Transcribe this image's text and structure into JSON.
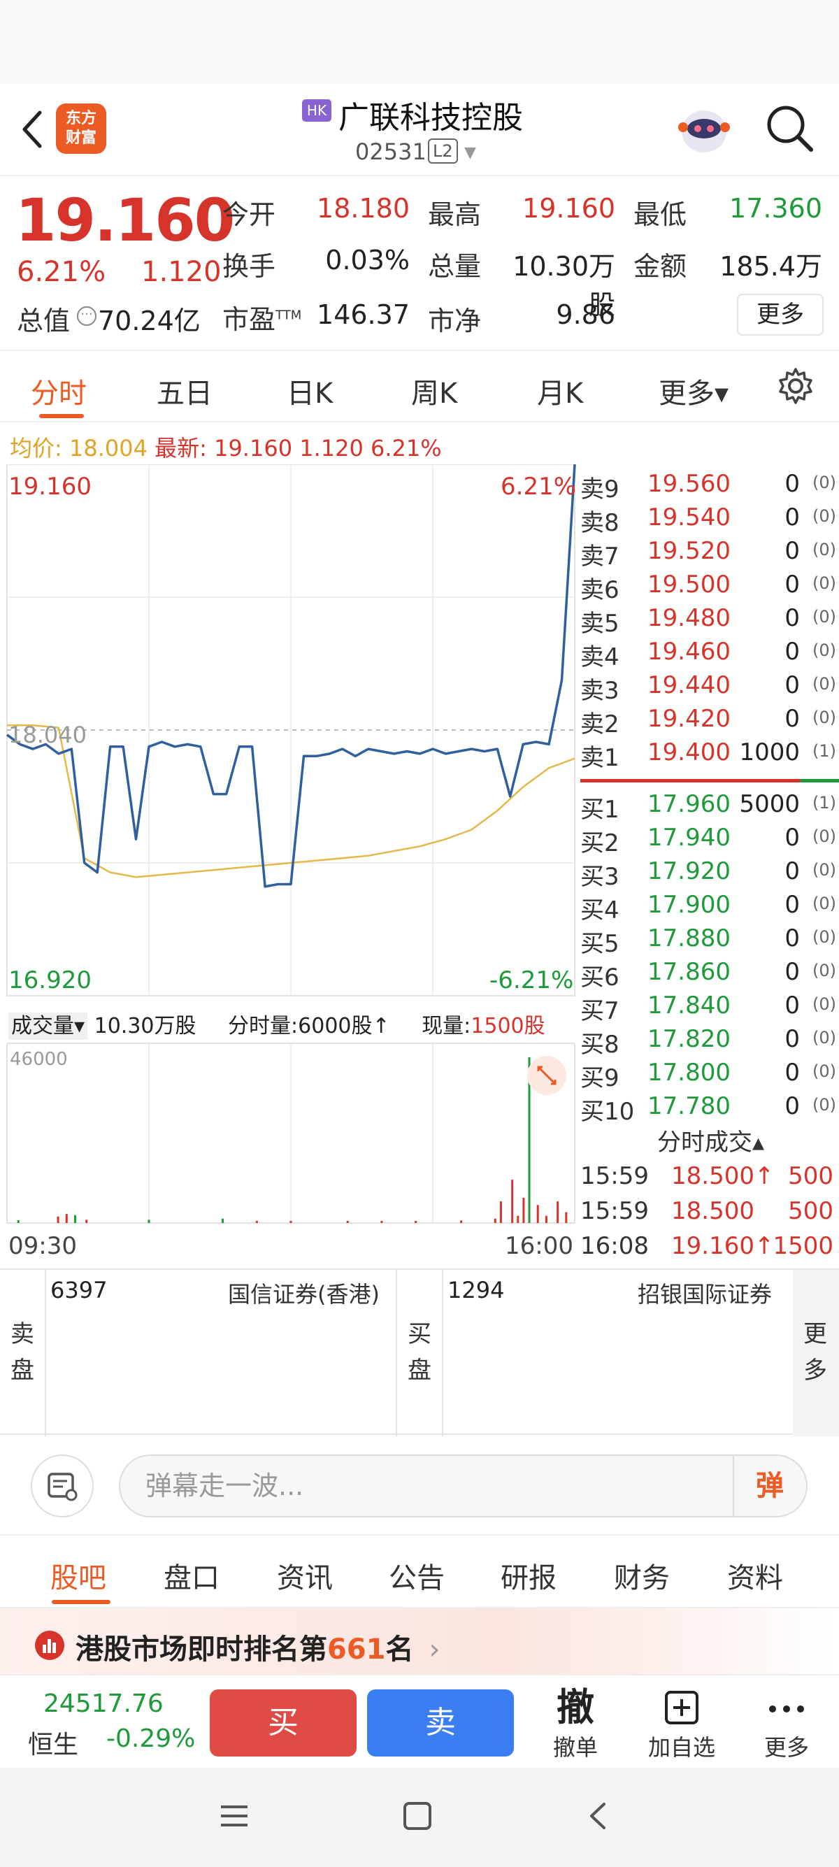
{
  "header": {
    "logo_text": "东方\n财富",
    "market_badge": "HK",
    "stock_name": "广联科技控股",
    "stock_code": "02531",
    "level_badge": "L2"
  },
  "quote": {
    "price": "19.160",
    "change_pct": "6.21%",
    "change": "1.120",
    "market_cap_label": "总值",
    "market_cap": "70.24亿",
    "rows": [
      [
        {
          "label": "今开",
          "value": "18.180",
          "color": "red"
        },
        {
          "label": "最高",
          "value": "19.160",
          "color": "red"
        },
        {
          "label": "最低",
          "value": "17.360",
          "color": "green"
        }
      ],
      [
        {
          "label": "换手",
          "value": "0.03%",
          "color": "dark"
        },
        {
          "label": "总量",
          "value": "10.30万股",
          "color": "dark"
        },
        {
          "label": "金额",
          "value": "185.4万",
          "color": "dark"
        }
      ]
    ],
    "pe_label": "市盈",
    "pe_sup": "TTM",
    "pe_value": "146.37",
    "pb_label": "市净",
    "pb_value": "9.86",
    "more_label": "更多"
  },
  "chart_tabs": [
    "分时",
    "五日",
    "日K",
    "周K",
    "月K",
    "更多▾"
  ],
  "avg_line": {
    "avg_label": "均价:",
    "avg_value": "18.004",
    "latest_label": "最新:",
    "latest_value": "19.160",
    "chg": "1.120",
    "pct": "6.21%"
  },
  "chart_data": {
    "type": "line",
    "title": "",
    "y_top": "19.160",
    "y_bottom": "16.920",
    "y_mid": "18.040",
    "pct_top": "6.21%",
    "pct_bottom": "-6.21%",
    "ylim": [
      16.92,
      19.16
    ],
    "x_start_label": "09:30",
    "x_end_label": "16:00",
    "series": [
      {
        "values": [
          18.02,
          17.98,
          17.96,
          17.98,
          17.94,
          17.96,
          17.48,
          17.44,
          17.97,
          17.97,
          17.58,
          17.97,
          17.99,
          17.97,
          17.98,
          17.97,
          17.77,
          17.77,
          17.97,
          17.97,
          17.38,
          17.39,
          17.39,
          17.93,
          17.93,
          17.94,
          17.96,
          17.93,
          17.96,
          17.95,
          17.94,
          17.95,
          17.94,
          17.96,
          17.94,
          17.95,
          17.96,
          17.95,
          17.96,
          17.76,
          17.98,
          17.99,
          17.98,
          18.25,
          19.16
        ]
      },
      {
        "values": [
          18.06,
          18.06,
          18.05,
          17.5,
          17.44,
          17.42,
          17.43,
          17.44,
          17.45,
          17.46,
          17.47,
          17.48,
          17.49,
          17.5,
          17.51,
          17.53,
          17.55,
          17.58,
          17.62,
          17.7,
          17.8,
          17.88,
          17.92
        ]
      }
    ],
    "volume": {
      "total_label": "成交量▾",
      "total_value": "10.30万股",
      "tick_label": "分时量:6000股↑",
      "now_label": "现量:",
      "now_value": "1500股",
      "ymax_label": "46000",
      "ylim": [
        0,
        46000
      ],
      "bars": [
        {
          "t": 0.02,
          "v": 800,
          "c": "green"
        },
        {
          "t": 0.09,
          "v": 1800,
          "c": "red"
        },
        {
          "t": 0.105,
          "v": 2500,
          "c": "red"
        },
        {
          "t": 0.12,
          "v": 2200,
          "c": "green"
        },
        {
          "t": 0.14,
          "v": 900,
          "c": "red"
        },
        {
          "t": 0.25,
          "v": 900,
          "c": "green"
        },
        {
          "t": 0.38,
          "v": 1200,
          "c": "green"
        },
        {
          "t": 0.44,
          "v": 600,
          "c": "red"
        },
        {
          "t": 0.5,
          "v": 600,
          "c": "red"
        },
        {
          "t": 0.6,
          "v": 500,
          "c": "red"
        },
        {
          "t": 0.66,
          "v": 500,
          "c": "red"
        },
        {
          "t": 0.72,
          "v": 500,
          "c": "red"
        },
        {
          "t": 0.8,
          "v": 700,
          "c": "red"
        },
        {
          "t": 0.86,
          "v": 1200,
          "c": "red"
        },
        {
          "t": 0.87,
          "v": 6000,
          "c": "red"
        },
        {
          "t": 0.89,
          "v": 12000,
          "c": "red"
        },
        {
          "t": 0.9,
          "v": 2000,
          "c": "red"
        },
        {
          "t": 0.91,
          "v": 7000,
          "c": "red"
        },
        {
          "t": 0.92,
          "v": 46000,
          "c": "green"
        },
        {
          "t": 0.935,
          "v": 5000,
          "c": "red"
        },
        {
          "t": 0.95,
          "v": 2000,
          "c": "red"
        },
        {
          "t": 0.97,
          "v": 6000,
          "c": "red"
        },
        {
          "t": 0.985,
          "v": 3000,
          "c": "red"
        }
      ]
    }
  },
  "orderbook": {
    "asks": [
      {
        "label": "卖9",
        "price": "19.560",
        "qty": "0",
        "count": "(0)"
      },
      {
        "label": "卖8",
        "price": "19.540",
        "qty": "0",
        "count": "(0)"
      },
      {
        "label": "卖7",
        "price": "19.520",
        "qty": "0",
        "count": "(0)"
      },
      {
        "label": "卖6",
        "price": "19.500",
        "qty": "0",
        "count": "(0)"
      },
      {
        "label": "卖5",
        "price": "19.480",
        "qty": "0",
        "count": "(0)"
      },
      {
        "label": "卖4",
        "price": "19.460",
        "qty": "0",
        "count": "(0)"
      },
      {
        "label": "卖3",
        "price": "19.440",
        "qty": "0",
        "count": "(0)"
      },
      {
        "label": "卖2",
        "price": "19.420",
        "qty": "0",
        "count": "(0)"
      },
      {
        "label": "卖1",
        "price": "19.400",
        "qty": "1000",
        "count": "(1)"
      }
    ],
    "bids": [
      {
        "label": "买1",
        "price": "17.960",
        "qty": "5000",
        "count": "(1)"
      },
      {
        "label": "买2",
        "price": "17.940",
        "qty": "0",
        "count": "(0)"
      },
      {
        "label": "买3",
        "price": "17.920",
        "qty": "0",
        "count": "(0)"
      },
      {
        "label": "买4",
        "price": "17.900",
        "qty": "0",
        "count": "(0)"
      },
      {
        "label": "买5",
        "price": "17.880",
        "qty": "0",
        "count": "(0)"
      },
      {
        "label": "买6",
        "price": "17.860",
        "qty": "0",
        "count": "(0)"
      },
      {
        "label": "买7",
        "price": "17.840",
        "qty": "0",
        "count": "(0)"
      },
      {
        "label": "买8",
        "price": "17.820",
        "qty": "0",
        "count": "(0)"
      },
      {
        "label": "买9",
        "price": "17.800",
        "qty": "0",
        "count": "(0)"
      },
      {
        "label": "买10",
        "price": "17.780",
        "qty": "0",
        "count": "(0)"
      }
    ]
  },
  "ticks": {
    "title": "分时成交▴",
    "rows": [
      {
        "time": "15:59",
        "price": "18.500↑",
        "vol": "500"
      },
      {
        "time": "15:59",
        "price": "18.500",
        "vol": "500"
      },
      {
        "time": "16:08",
        "price": "19.160↑",
        "vol": "1500"
      }
    ]
  },
  "brokers": {
    "sell_label": "卖\n盘",
    "sell_id": "6397",
    "sell_name": "国信证券(香港)",
    "buy_label": "买\n盘",
    "buy_id": "1294",
    "buy_name": "招银国际证券",
    "more_label": "更\n多"
  },
  "danmaku": {
    "placeholder": "弹幕走一波...",
    "send_label": "弹"
  },
  "bottom_tabs": [
    "股吧",
    "盘口",
    "资讯",
    "公告",
    "研报",
    "财务",
    "资料"
  ],
  "rank": {
    "prefix": "港股市场即时排名第",
    "number": "661",
    "suffix": "名",
    "arrow": "›"
  },
  "tradebar": {
    "index_value": "24517.76",
    "index_name": "恒生",
    "index_pct": "-0.29%",
    "buy_label": "买",
    "sell_label": "卖",
    "cancel_glyph": "撤",
    "cancel_label": "撤单",
    "add_label": "加自选",
    "more_label": "更多"
  },
  "colors": {
    "accent": "#ec5b24",
    "up": "#d6332b",
    "down": "#1f9a3a",
    "price_line": "#2f5f9e",
    "avg_line": "#e5b84a"
  }
}
